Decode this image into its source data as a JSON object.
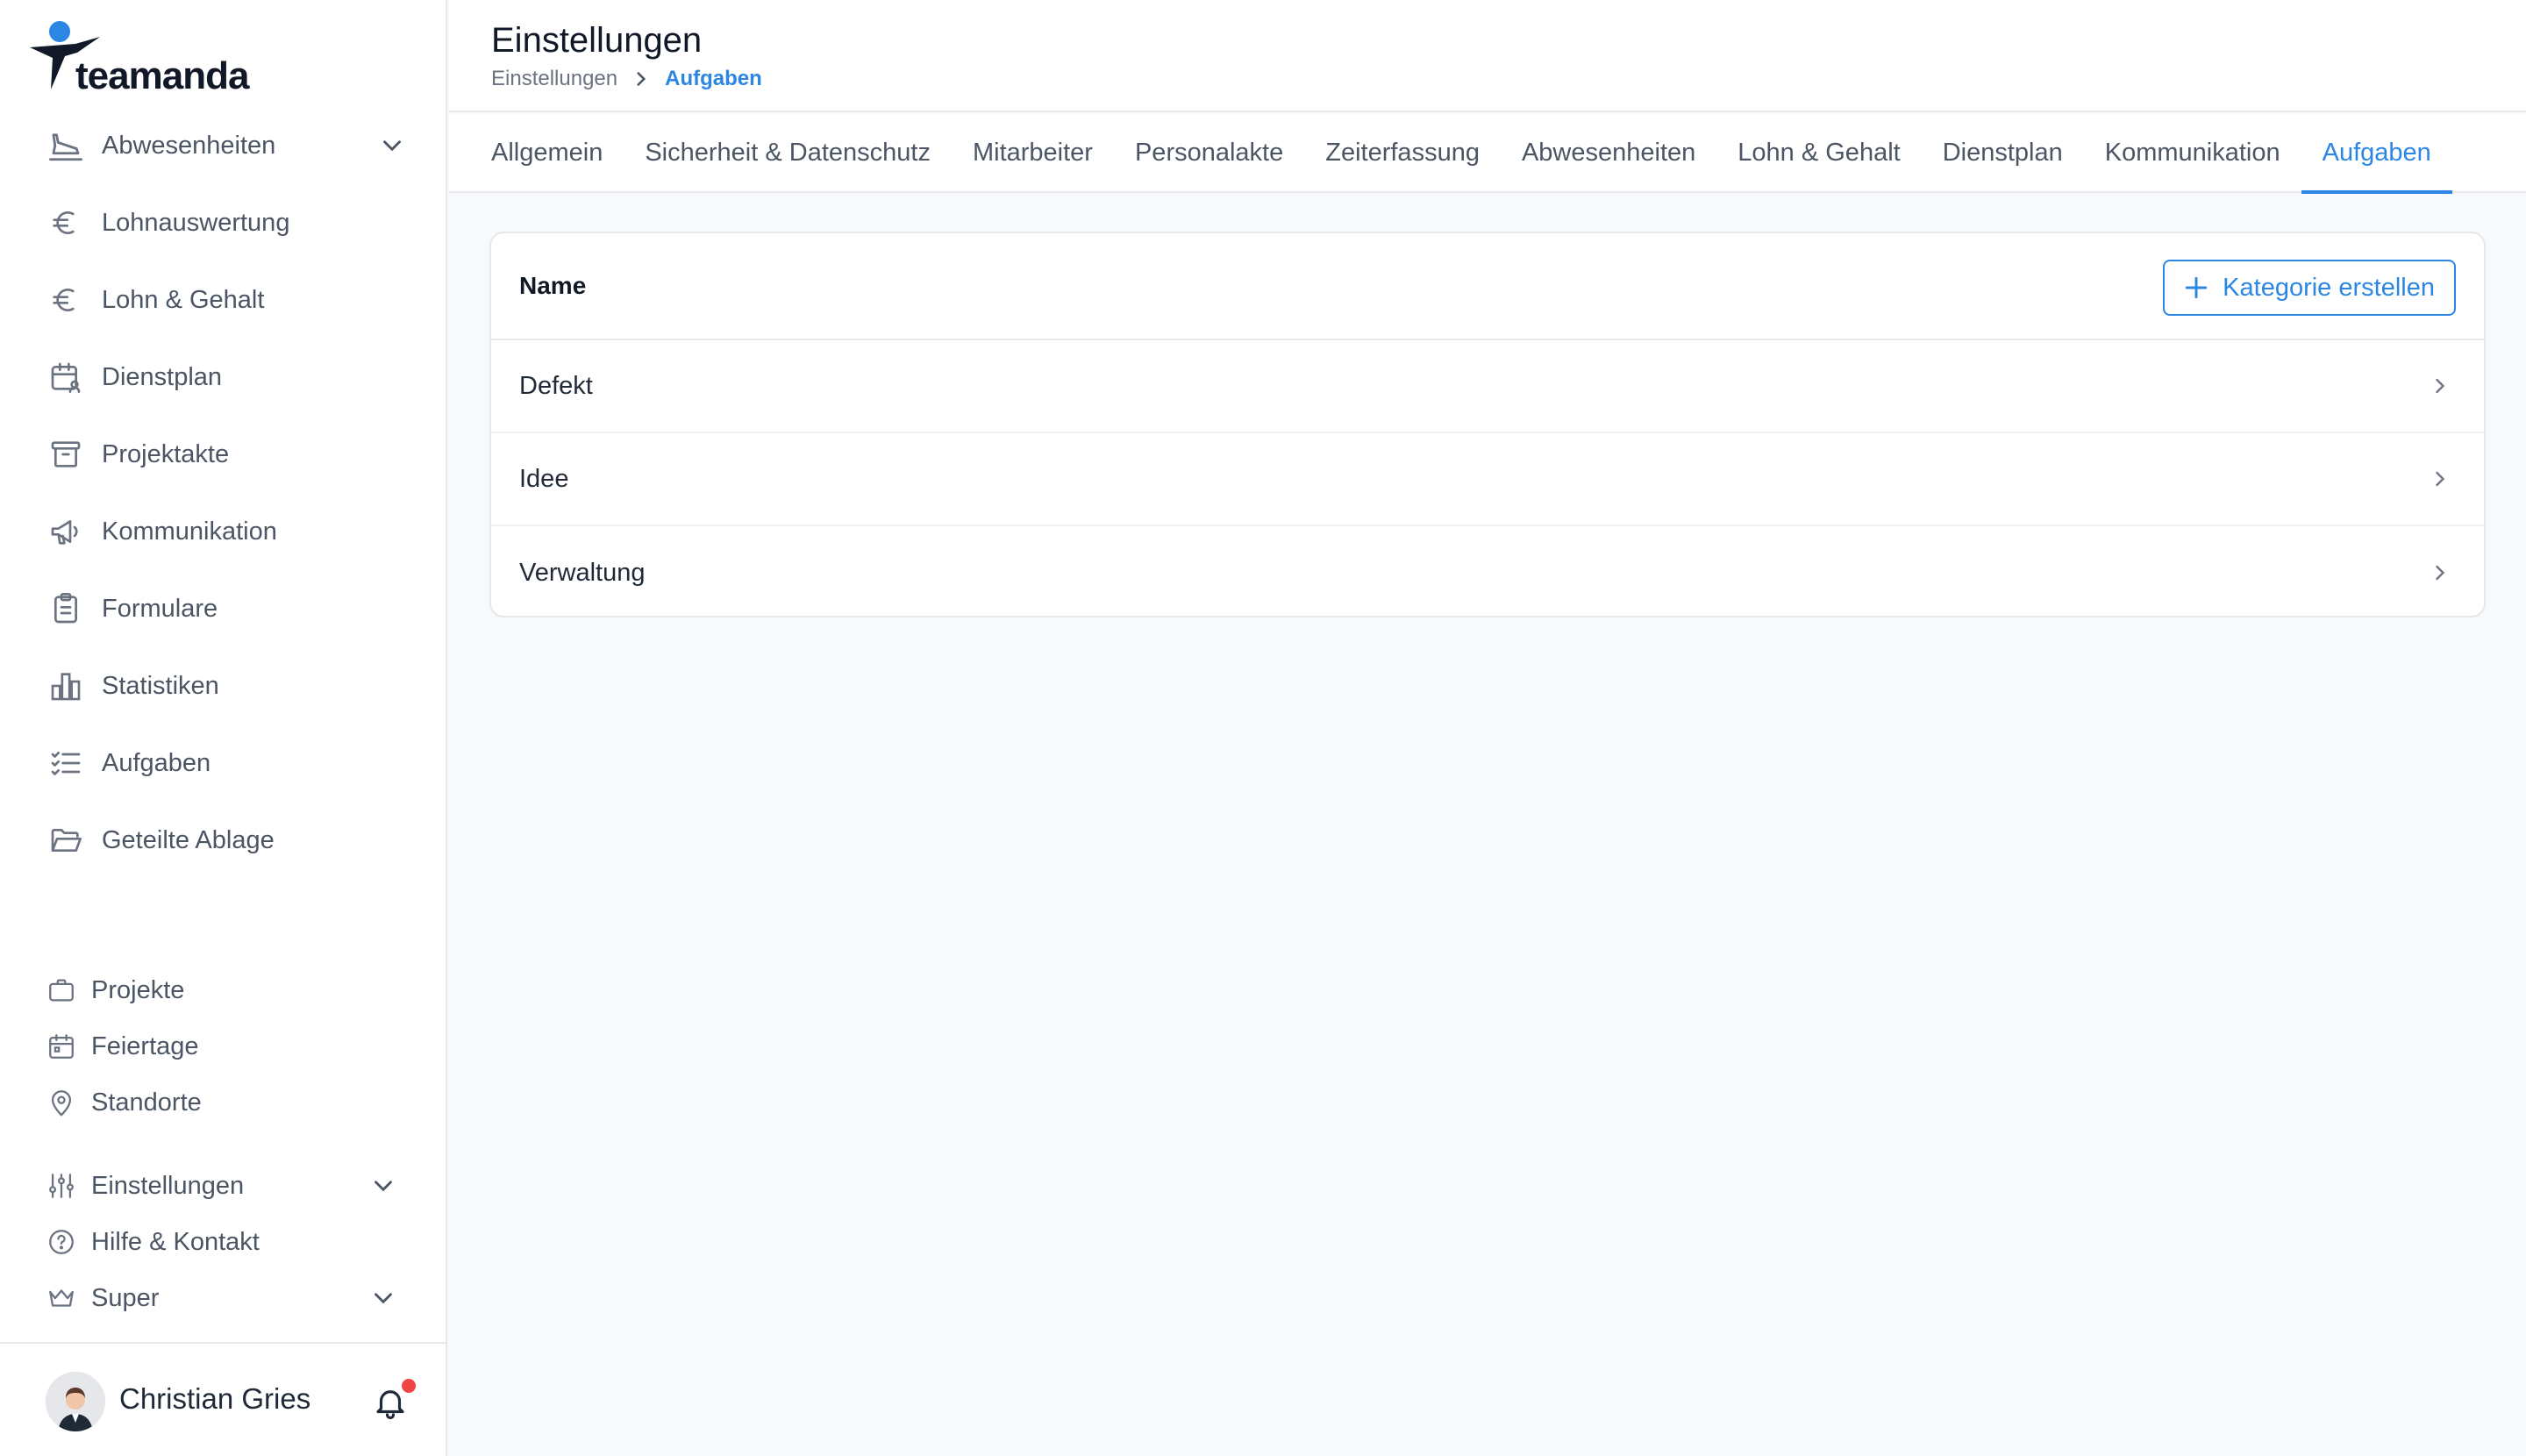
{
  "app": {
    "logo_text": "teamanda"
  },
  "sidebar": {
    "main_items": [
      {
        "label": "Abwesenheiten",
        "icon": "plane-landing-icon",
        "expandable": true
      },
      {
        "label": "Lohnauswertung",
        "icon": "euro-icon"
      },
      {
        "label": "Lohn & Gehalt",
        "icon": "euro-icon"
      },
      {
        "label": "Dienstplan",
        "icon": "calendar-user-icon"
      },
      {
        "label": "Projektakte",
        "icon": "archive-icon"
      },
      {
        "label": "Kommunikation",
        "icon": "megaphone-icon"
      },
      {
        "label": "Formulare",
        "icon": "clipboard-icon"
      },
      {
        "label": "Statistiken",
        "icon": "bar-chart-icon"
      },
      {
        "label": "Aufgaben",
        "icon": "checklist-icon"
      },
      {
        "label": "Geteilte Ablage",
        "icon": "folder-open-icon"
      }
    ],
    "secondary_items": [
      {
        "label": "Projekte",
        "icon": "briefcase-icon"
      },
      {
        "label": "Feiertage",
        "icon": "calendar-icon"
      },
      {
        "label": "Standorte",
        "icon": "map-pin-icon"
      }
    ],
    "tertiary_items": [
      {
        "label": "Einstellungen",
        "icon": "sliders-icon",
        "expandable": true
      },
      {
        "label": "Hilfe & Kontakt",
        "icon": "help-circle-icon"
      },
      {
        "label": "Super",
        "icon": "crown-icon",
        "expandable": true
      }
    ],
    "user": {
      "name": "Christian Gries",
      "has_notification": true
    }
  },
  "header": {
    "title": "Einstellungen",
    "breadcrumb": [
      "Einstellungen",
      "Aufgaben"
    ]
  },
  "tabs": [
    {
      "label": "Allgemein",
      "active": false
    },
    {
      "label": "Sicherheit & Datenschutz",
      "active": false
    },
    {
      "label": "Mitarbeiter",
      "active": false
    },
    {
      "label": "Personalakte",
      "active": false
    },
    {
      "label": "Zeiterfassung",
      "active": false
    },
    {
      "label": "Abwesenheiten",
      "active": false
    },
    {
      "label": "Lohn & Gehalt",
      "active": false
    },
    {
      "label": "Dienstplan",
      "active": false
    },
    {
      "label": "Kommunikation",
      "active": false
    },
    {
      "label": "Aufgaben",
      "active": true
    }
  ],
  "table": {
    "column_header": "Name",
    "create_button": "Kategorie erstellen",
    "rows": [
      "Defekt",
      "Idee",
      "Verwaltung"
    ]
  },
  "colors": {
    "accent": "#2b86e4",
    "text": "#1f2937",
    "muted": "#4b5563",
    "border": "#e5e7eb",
    "background": "#f8f9fb",
    "notification": "#ef4444"
  }
}
